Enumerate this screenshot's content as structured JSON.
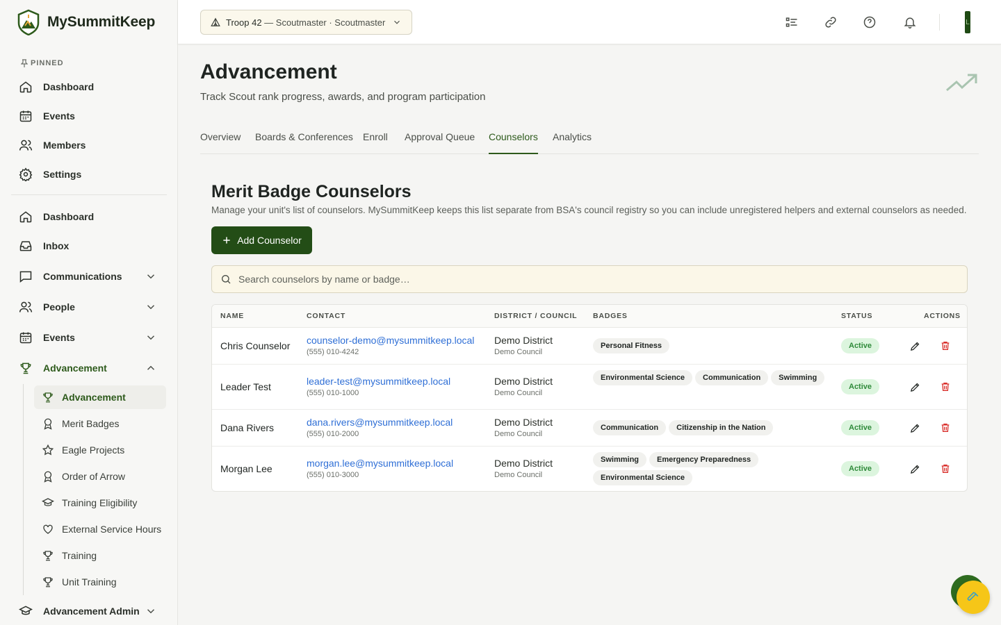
{
  "brand": {
    "name": "MySummitKeep"
  },
  "sidebar": {
    "pinned_label": "PINNED",
    "pinned": [
      {
        "label": "Dashboard",
        "icon": "home-icon"
      },
      {
        "label": "Events",
        "icon": "calendar-icon"
      },
      {
        "label": "Members",
        "icon": "users-icon"
      },
      {
        "label": "Settings",
        "icon": "gear-icon"
      }
    ],
    "main": [
      {
        "label": "Dashboard",
        "icon": "home-icon"
      },
      {
        "label": "Inbox",
        "icon": "inbox-icon"
      },
      {
        "label": "Communications",
        "icon": "message-icon",
        "expandable": true
      },
      {
        "label": "People",
        "icon": "users-icon",
        "expandable": true
      },
      {
        "label": "Events",
        "icon": "calendar-icon",
        "expandable": true
      },
      {
        "label": "Advancement",
        "icon": "trophy-icon",
        "expandable": true,
        "expanded": true
      }
    ],
    "sub": [
      {
        "label": "Advancement",
        "icon": "trophy-icon",
        "active": true
      },
      {
        "label": "Merit Badges",
        "icon": "medal-icon"
      },
      {
        "label": "Eagle Projects",
        "icon": "star-icon"
      },
      {
        "label": "Order of Arrow",
        "icon": "medal-icon"
      },
      {
        "label": "Training Eligibility",
        "icon": "graduation-cap-icon"
      },
      {
        "label": "External Service Hours",
        "icon": "heart-icon"
      },
      {
        "label": "Training",
        "icon": "trophy-icon"
      },
      {
        "label": "Unit Training",
        "icon": "trophy-icon"
      }
    ],
    "bottom": {
      "label": "Advancement Admin",
      "icon": "graduation-cap-icon"
    }
  },
  "topbar": {
    "troop_name": "Troop 42",
    "troop_role": " — Scoutmaster · Scoutmaster",
    "avatar_initial": "L"
  },
  "page": {
    "title": "Advancement",
    "subtitle": "Track Scout rank progress, awards, and program participation",
    "tabs": [
      "Overview",
      "Boards & Conferences",
      "Enroll",
      "Approval Queue",
      "Counselors",
      "Analytics"
    ],
    "active_tab": "Counselors"
  },
  "section": {
    "title": "Merit Badge Counselors",
    "description": "Manage your unit's list of counselors. MySummitKeep keeps this list separate from BSA's council registry so you can include unregistered helpers and external counselors as needed.",
    "add_button": "Add Counselor",
    "search_placeholder": "Search counselors by name or badge…"
  },
  "table": {
    "headers": {
      "name": "NAME",
      "contact": "CONTACT",
      "district": "DISTRICT / COUNCIL",
      "badges": "BADGES",
      "status": "STATUS",
      "actions": "ACTIONS"
    },
    "rows": [
      {
        "name": "Chris Counselor",
        "email": "counselor-demo@mysummitkeep.local",
        "phone": "(555) 010-4242",
        "district": "Demo District",
        "council": "Demo Council",
        "badges": [
          "Personal Fitness"
        ],
        "status": "Active"
      },
      {
        "name": "Leader Test",
        "email": "leader-test@mysummitkeep.local",
        "phone": "(555) 010-1000",
        "district": "Demo District",
        "council": "Demo Council",
        "badges": [
          "Environmental Science",
          "Communication",
          "Swimming"
        ],
        "status": "Active"
      },
      {
        "name": "Dana Rivers",
        "email": "dana.rivers@mysummitkeep.local",
        "phone": "(555) 010-2000",
        "district": "Demo District",
        "council": "Demo Council",
        "badges": [
          "Communication",
          "Citizenship in the Nation"
        ],
        "status": "Active"
      },
      {
        "name": "Morgan Lee",
        "email": "morgan.lee@mysummitkeep.local",
        "phone": "(555) 010-3000",
        "district": "Demo District",
        "council": "Demo Council",
        "badges": [
          "Swimming",
          "Emergency Preparedness",
          "Environmental Science"
        ],
        "status": "Active"
      }
    ]
  },
  "colors": {
    "brand_green": "#234d16",
    "link_blue": "#2f6fd6",
    "delete_red": "#d9302c",
    "status_green": "#2f8a3a",
    "fab_yellow": "#f6c618"
  }
}
